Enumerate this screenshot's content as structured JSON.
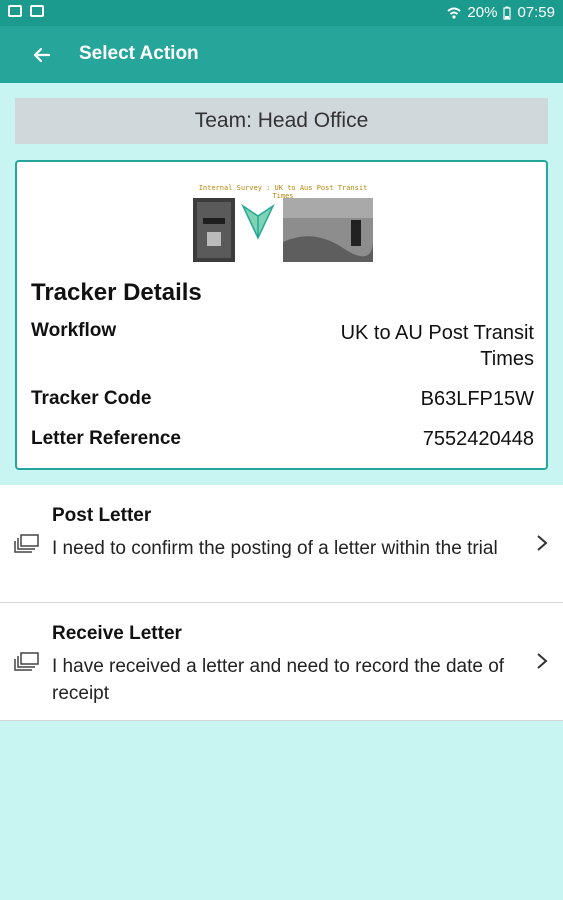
{
  "status_bar": {
    "battery": "20%",
    "time": "07:59"
  },
  "app_bar": {
    "title": "Select Action"
  },
  "team": {
    "label": "Team: Head Office"
  },
  "tracker": {
    "image_caption": "Internal Survey : UK to Aus Post Transit Times",
    "title": "Tracker Details",
    "rows": [
      {
        "label": "Workflow",
        "value_line1": "UK to AU Post Transit",
        "value_line2": "Times"
      },
      {
        "label": "Tracker Code",
        "value": "B63LFP15W"
      },
      {
        "label": "Letter Reference",
        "value": "7552420448"
      }
    ]
  },
  "actions": [
    {
      "title": "Post Letter",
      "desc": "I need to confirm the posting of a letter within the trial"
    },
    {
      "title": "Receive Letter",
      "desc": "I have received a letter and need to record the date of receipt"
    }
  ],
  "icons": {
    "back": "arrow-left-icon",
    "chevron": "chevron-right-icon",
    "action": "stacked-letters-icon"
  },
  "colors": {
    "app_bar": "#26a69a",
    "status_bar": "#1b9a8e",
    "background": "#c8f4f1",
    "card_border": "#26a69a"
  }
}
